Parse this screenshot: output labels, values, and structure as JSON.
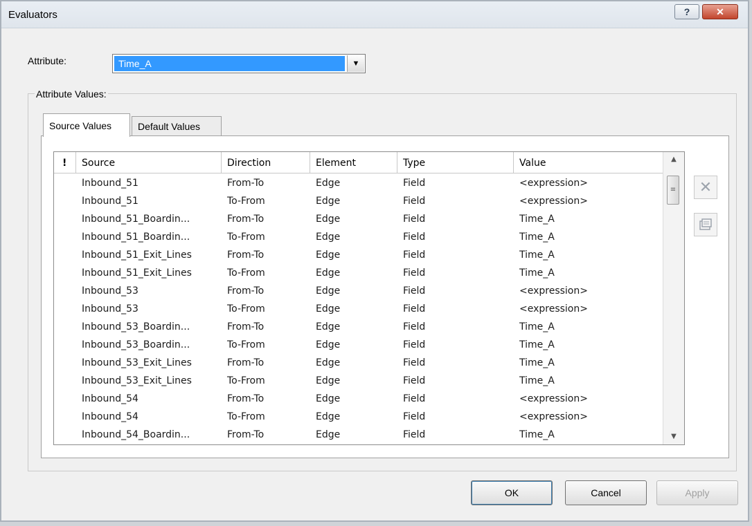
{
  "window": {
    "title": "Evaluators"
  },
  "attribute": {
    "label": "Attribute:",
    "selected": "Time_A"
  },
  "group": {
    "title": "Attribute Values:"
  },
  "tabs": [
    {
      "label": "Source Values"
    },
    {
      "label": "Default Values"
    }
  ],
  "grid": {
    "columns": [
      "!",
      "Source",
      "Direction",
      "Element",
      "Type",
      "Value"
    ],
    "rows": [
      [
        "Inbound_51",
        "From-To",
        "Edge",
        "Field",
        "<expression>"
      ],
      [
        "Inbound_51",
        "To-From",
        "Edge",
        "Field",
        "<expression>"
      ],
      [
        "Inbound_51_Boardin...",
        "From-To",
        "Edge",
        "Field",
        "Time_A"
      ],
      [
        "Inbound_51_Boardin...",
        "To-From",
        "Edge",
        "Field",
        "Time_A"
      ],
      [
        "Inbound_51_Exit_Lines",
        "From-To",
        "Edge",
        "Field",
        "Time_A"
      ],
      [
        "Inbound_51_Exit_Lines",
        "To-From",
        "Edge",
        "Field",
        "Time_A"
      ],
      [
        "Inbound_53",
        "From-To",
        "Edge",
        "Field",
        "<expression>"
      ],
      [
        "Inbound_53",
        "To-From",
        "Edge",
        "Field",
        "<expression>"
      ],
      [
        "Inbound_53_Boardin...",
        "From-To",
        "Edge",
        "Field",
        "Time_A"
      ],
      [
        "Inbound_53_Boardin...",
        "To-From",
        "Edge",
        "Field",
        "Time_A"
      ],
      [
        "Inbound_53_Exit_Lines",
        "From-To",
        "Edge",
        "Field",
        "Time_A"
      ],
      [
        "Inbound_53_Exit_Lines",
        "To-From",
        "Edge",
        "Field",
        "Time_A"
      ],
      [
        "Inbound_54",
        "From-To",
        "Edge",
        "Field",
        "<expression>"
      ],
      [
        "Inbound_54",
        "To-From",
        "Edge",
        "Field",
        "<expression>"
      ],
      [
        "Inbound_54_Boardin...",
        "From-To",
        "Edge",
        "Field",
        "Time_A"
      ]
    ]
  },
  "buttons": {
    "ok": "OK",
    "cancel": "Cancel",
    "apply": "Apply"
  }
}
